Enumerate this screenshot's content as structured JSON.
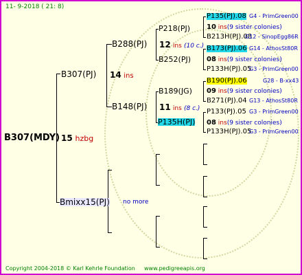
{
  "header": {
    "date": "11-  9-2018 ( 21:  8)"
  },
  "footer": {
    "copyright": "Copyright 2004-2018 © Karl Kehrle Foundation",
    "website": "www.pedigreeapis.org"
  },
  "tree": {
    "root": {
      "label": "B307(MDY)",
      "num": "15",
      "suffix": "hzbg"
    },
    "sire": {
      "label": "B307(PJ)",
      "num": "14",
      "suffix": "ins"
    },
    "dam": {
      "label": "Bmixx15(PJ)",
      "note": "no more"
    },
    "ss": {
      "label": "B288(PJ)",
      "num": "12",
      "suffix": "ins",
      "extra": "(10 c.)"
    },
    "sd": {
      "label": "B148(PJ)",
      "num": "11",
      "suffix": "ins",
      "extra": "(8 c.)"
    },
    "sss": {
      "label": "P218(PJ)",
      "num": "10",
      "suffix": "ins",
      "extra": "(9 sister colonies)"
    },
    "ssd": {
      "label": "B252(PJ)",
      "num": "08",
      "suffix": "ins",
      "extra": "(9 sister colonies)"
    },
    "sds": {
      "label": "B189(JG)",
      "num": "09",
      "suffix": "ins",
      "extra": "(9 sister colonies)"
    },
    "sdd": {
      "label": "P135H(PJ)",
      "num": "08",
      "suffix": "ins",
      "extra": "(9 sister colonies)"
    },
    "g4": [
      {
        "label": "P135(PJ).08",
        "tag": "G4 - PrimGreen00"
      },
      {
        "label": "B213H(PJ).08",
        "tag": "G12 - SinopEgg86R"
      },
      {
        "label": "B173(PJ).06",
        "tag": "G14 - AthosSt80R"
      },
      {
        "label": "P133H(PJ).05",
        "tag": "G3 - PrimGreen00"
      },
      {
        "label": "B190(PJ).06",
        "tag": "G28 - B-xx43"
      },
      {
        "label": "B271(PJ).04",
        "tag": "G13 - AthosSt80R"
      },
      {
        "label": "P133(PJ).05",
        "tag": "G3 - PrimGreen00"
      },
      {
        "label": "P133H(PJ).05",
        "tag": "G3 - PrimGreen00"
      }
    ]
  },
  "colors": {
    "border": "#d000d0",
    "background": "#ffffe6",
    "highlight_cyan": "#22d8e8",
    "highlight_yellow": "#ffff00",
    "tag_blue": "#0000c0",
    "ins_red": "#c00000",
    "footer_green": "#008000"
  }
}
